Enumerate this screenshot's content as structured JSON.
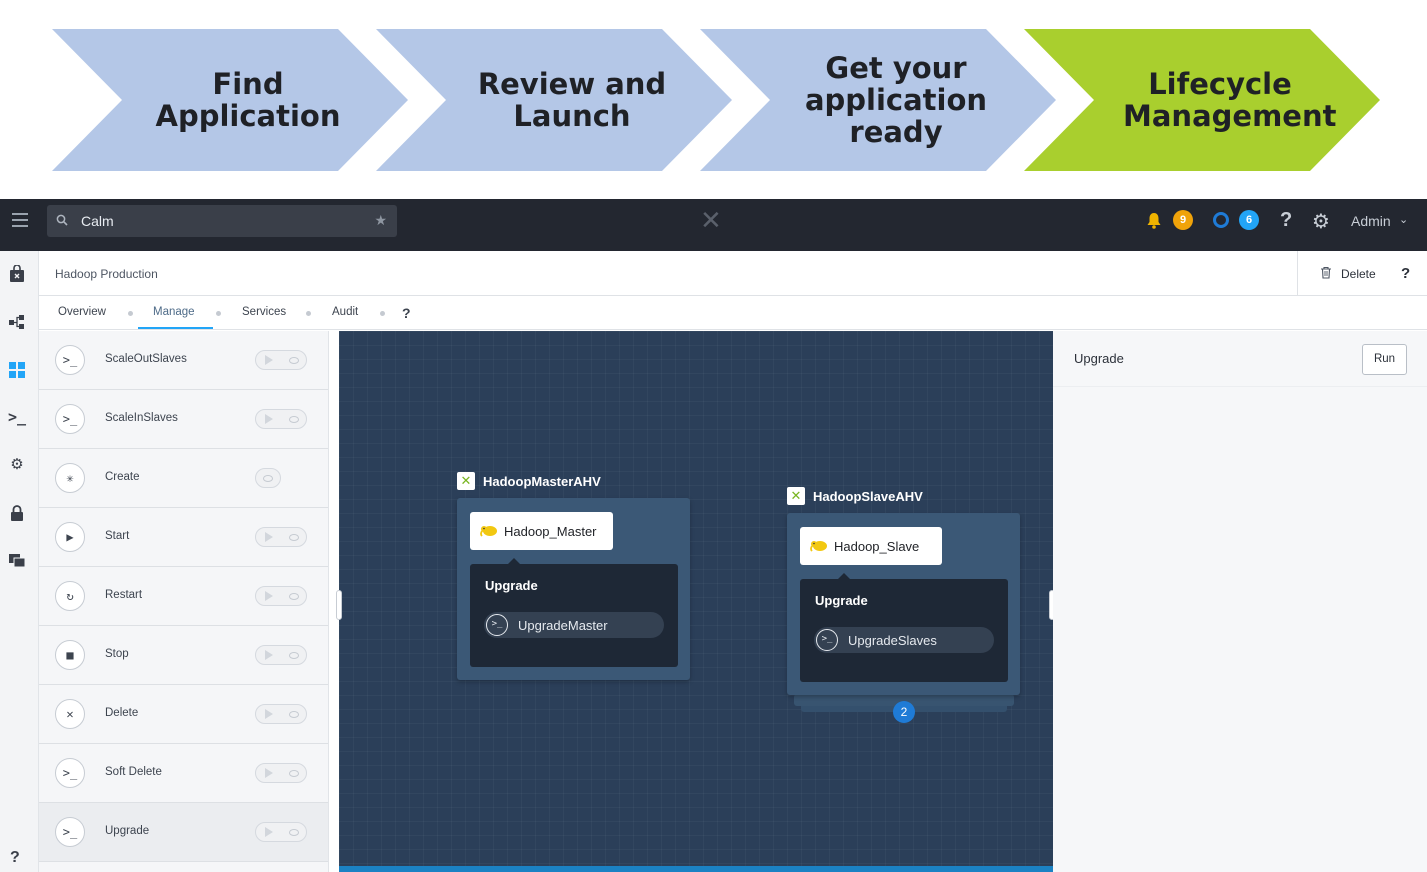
{
  "banner": {
    "steps": [
      {
        "label": "Find\nApplication",
        "color": "#b4c7e7"
      },
      {
        "label": "Review and\nLaunch",
        "color": "#b4c7e7"
      },
      {
        "label": "Get your\napplication\nready",
        "color": "#b4c7e7"
      },
      {
        "label": "Lifecycle\nManagement",
        "color": "#a9cf2e"
      }
    ]
  },
  "topnav": {
    "search_value": "Calm",
    "alerts_count": "9",
    "tasks_count": "6",
    "help": "?",
    "user": "Admin"
  },
  "page": {
    "title": "Hadoop Production",
    "delete_label": "Delete",
    "help": "?"
  },
  "tabs": {
    "items": [
      "Overview",
      "Manage",
      "Services",
      "Audit"
    ],
    "active": "Manage",
    "help": "?"
  },
  "actions": [
    {
      "label": "ScaleOutSlaves",
      "icon": "terminal-icon"
    },
    {
      "label": "ScaleInSlaves",
      "icon": "terminal-icon"
    },
    {
      "label": "Create",
      "icon": "sparkle-icon"
    },
    {
      "label": "Start",
      "icon": "play-icon"
    },
    {
      "label": "Restart",
      "icon": "restart-icon"
    },
    {
      "label": "Stop",
      "icon": "stop-icon"
    },
    {
      "label": "Delete",
      "icon": "x-icon"
    },
    {
      "label": "Soft Delete",
      "icon": "terminal-icon"
    },
    {
      "label": "Upgrade",
      "icon": "terminal-icon"
    }
  ],
  "canvas": {
    "services": [
      {
        "name": "HadoopMasterAHV",
        "package": "Hadoop_Master",
        "action": "Upgrade",
        "task": "UpgradeMaster"
      },
      {
        "name": "HadoopSlaveAHV",
        "package": "Hadoop_Slave",
        "action": "Upgrade",
        "task": "UpgradeSlaves",
        "replicas": "2"
      }
    ]
  },
  "right_panel": {
    "title": "Upgrade",
    "run_label": "Run"
  },
  "colors": {
    "nav_bg": "#232730",
    "canvas_bg": "#2b3f59",
    "accent": "#22a5f7",
    "alert_badge": "#f0a30a"
  }
}
